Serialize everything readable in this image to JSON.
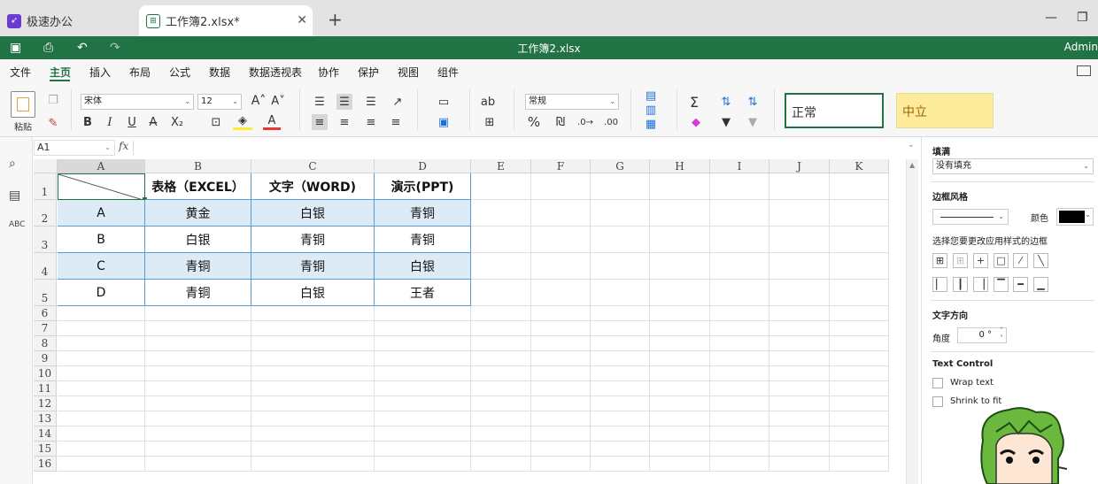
{
  "tabs": [
    {
      "label": "极速办公",
      "icon": "rocket-icon"
    },
    {
      "label": "工作簿2.xlsx*",
      "icon": "spreadsheet-icon"
    }
  ],
  "titlebar": {
    "title": "工作簿2.xlsx",
    "user": "Admin"
  },
  "menu": [
    "文件",
    "主页",
    "插入",
    "布局",
    "公式",
    "数据",
    "数据透视表",
    "协作",
    "保护",
    "视图",
    "组件"
  ],
  "ribbon": {
    "paste_label": "粘贴",
    "font_name": "宋体",
    "font_size": "12",
    "number_format": "常规",
    "style_normal": "正常",
    "style_neutral": "中立"
  },
  "namebox": "A1",
  "fx": "fx",
  "columns": [
    "A",
    "B",
    "C",
    "D",
    "E",
    "F",
    "G",
    "H",
    "I",
    "J",
    "K"
  ],
  "rows": [
    "1",
    "2",
    "3",
    "4",
    "5",
    "6",
    "7",
    "8",
    "9",
    "10",
    "11",
    "12",
    "13",
    "14",
    "15",
    "16"
  ],
  "table": {
    "header": [
      "",
      "表格（EXCEL）",
      "文字（WORD)",
      "演示(PPT)"
    ],
    "body": [
      [
        "A",
        "黄金",
        "白银",
        "青铜"
      ],
      [
        "B",
        "白银",
        "青铜",
        "青铜"
      ],
      [
        "C",
        "青铜",
        "青铜",
        "白银"
      ],
      [
        "D",
        "青铜",
        "白银",
        "王者"
      ]
    ]
  },
  "panel": {
    "fill_title": "填满",
    "fill_value": "没有填充",
    "border_title": "边框风格",
    "color_label": "颜色",
    "border_hint": "选择您要更改应用样式的边框",
    "text_dir_title": "文字方向",
    "angle_label": "角度",
    "angle_value": "0 °",
    "text_control_title": "Text Control",
    "wrap_text": "Wrap text",
    "shrink_to_fit": "Shrink to fit"
  },
  "colors": {
    "accent": "#217346",
    "row_highlight": "#ddebf7",
    "style_neutral_bg": "#ffeb9c"
  }
}
